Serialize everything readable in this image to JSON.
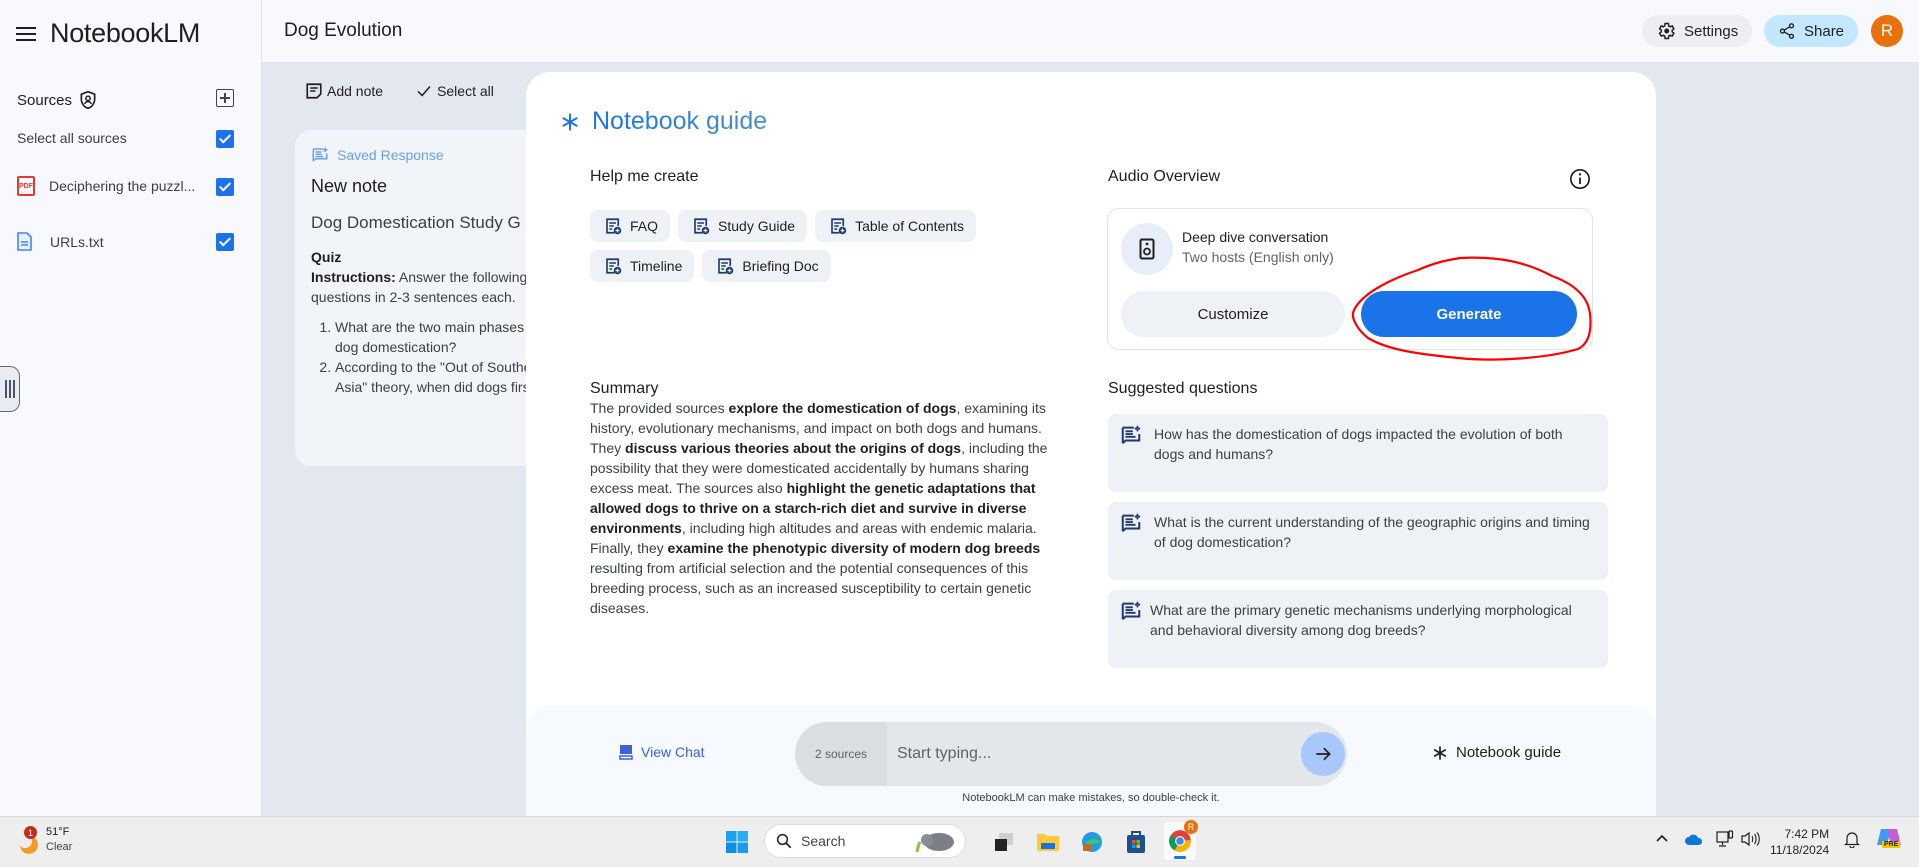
{
  "app": {
    "name": "NotebookLM",
    "notebook_title": "Dog Evolution"
  },
  "header": {
    "settings_label": "Settings",
    "share_label": "Share",
    "avatar_initial": "R"
  },
  "sidebar": {
    "sources_label": "Sources",
    "select_all_label": "Select all sources",
    "select_all_checked": true,
    "sources": [
      {
        "name": "Deciphering the puzzl...",
        "type": "pdf",
        "type_label": "PDF",
        "checked": true
      },
      {
        "name": "URLs.txt",
        "type": "text",
        "checked": true
      }
    ]
  },
  "notes": {
    "add_note_label": "Add note",
    "select_all_label": "Select all",
    "card": {
      "tag": "Saved Response",
      "title": "New note",
      "subtitle": "Dog Domestication Study G",
      "section": "Quiz",
      "instructions_label": "Instructions:",
      "instructions_text": " Answer the following questions in 2-3 sentences each.",
      "items": [
        "What are the two main phases of dog domestication?",
        "According to the \"Out of Southeast Asia\" theory, when did dogs first..."
      ]
    }
  },
  "guide": {
    "title": "Notebook guide",
    "help_label": "Help me create",
    "chips": [
      "FAQ",
      "Study Guide",
      "Table of Contents",
      "Timeline",
      "Briefing Doc"
    ],
    "summary_label": "Summary",
    "summary_parts": [
      {
        "t": "The provided sources ",
        "b": false
      },
      {
        "t": "explore the domestication of dogs",
        "b": true
      },
      {
        "t": ", examining its history, evolutionary mechanisms, and impact on both dogs and humans. They ",
        "b": false
      },
      {
        "t": "discuss various theories about the origins of dogs",
        "b": true
      },
      {
        "t": ", including the possibility that they were domesticated accidentally by humans sharing excess meat. The sources also ",
        "b": false
      },
      {
        "t": "highlight the genetic adaptations that allowed dogs to thrive on a starch-rich diet and survive in diverse environments",
        "b": true
      },
      {
        "t": ", including high altitudes and areas with endemic malaria. Finally, they ",
        "b": false
      },
      {
        "t": "examine the phenotypic diversity of modern dog breeds",
        "b": true
      },
      {
        "t": " resulting from artificial selection and the potential consequences of this breeding process, such as an increased susceptibility to certain genetic diseases.",
        "b": false
      }
    ],
    "audio": {
      "label": "Audio Overview",
      "title": "Deep dive conversation",
      "subtitle": "Two hosts (English only)",
      "customize_label": "Customize",
      "generate_label": "Generate"
    },
    "suggested_label": "Suggested questions",
    "questions": [
      "How has the domestication of dogs impacted the evolution of both dogs and humans?",
      "What is the current understanding of the geographic origins and timing of dog domestication?",
      "What are the primary genetic mechanisms underlying morphological and behavioral diversity among dog breeds?"
    ]
  },
  "chat": {
    "view_chat_label": "View Chat",
    "sources_count": "2 sources",
    "placeholder": "Start typing...",
    "notebook_guide_label": "Notebook guide",
    "disclaimer": "NotebookLM can make mistakes, so double-check it."
  },
  "colors": {
    "accent": "#1a73e8",
    "share_bg": "#c2e7ff",
    "avatar_bg": "#e8710a",
    "annotation": "#ff0000"
  },
  "taskbar": {
    "weather_temp": "51°F",
    "weather_cond": "Clear",
    "weather_badge": "1",
    "search_label": "Search",
    "time": "7:42 PM",
    "date": "11/18/2024",
    "copilot_badge": "PRE",
    "chrome_badge": "R"
  }
}
